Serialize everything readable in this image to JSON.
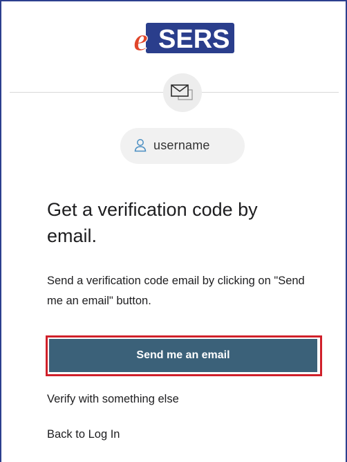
{
  "logo": {
    "prefix": "e",
    "name": "SERS",
    "prefix_color": "#e0462a",
    "background_color": "#2a3e8c"
  },
  "divider_icon": "mail-icon",
  "user": {
    "icon": "person-icon",
    "username": "username"
  },
  "main": {
    "heading": "Get a verification code by email.",
    "description": "Send a verification code email by clicking on \"Send me an email\" button."
  },
  "actions": {
    "send_label": "Send me an email",
    "send_color": "#3b6179",
    "highlight_color": "#d0202a",
    "verify_other_label": "Verify with something else",
    "back_label": "Back to Log In"
  }
}
